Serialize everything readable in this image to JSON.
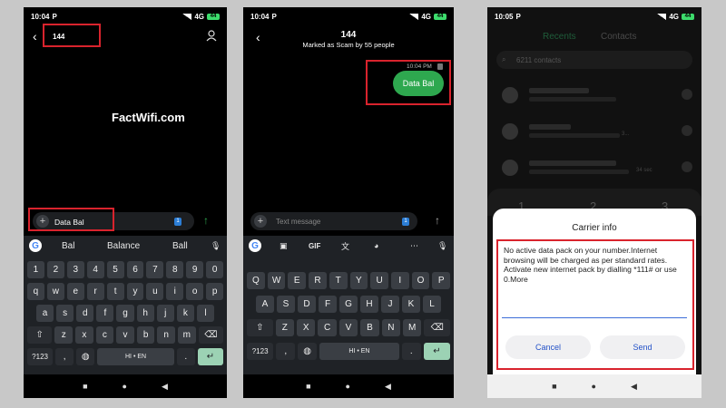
{
  "phone1": {
    "status": {
      "time": "10:04",
      "carrier_icon": "P",
      "network": "4G",
      "battery": "44"
    },
    "header": {
      "number": "144"
    },
    "watermark": "FactWifi.com",
    "compose": {
      "text": "Data Bal",
      "sim_badge": "1"
    },
    "suggestions": [
      "Bal",
      "Balance",
      "Ball"
    ],
    "keys": {
      "row1": [
        "1",
        "2",
        "3",
        "4",
        "5",
        "6",
        "7",
        "8",
        "9",
        "0"
      ],
      "row2": [
        "q",
        "w",
        "e",
        "r",
        "t",
        "y",
        "u",
        "i",
        "o",
        "p"
      ],
      "row3": [
        "a",
        "s",
        "d",
        "f",
        "g",
        "h",
        "j",
        "k",
        "l"
      ],
      "row4": [
        "z",
        "x",
        "c",
        "v",
        "b",
        "n",
        "m"
      ],
      "sym": "?123",
      "lang": "HI • EN",
      "dot": ".",
      "comma": ","
    }
  },
  "phone2": {
    "status": {
      "time": "10:04",
      "carrier_icon": "P",
      "network": "4G",
      "battery": "44"
    },
    "header": {
      "number": "144",
      "subtitle": "Marked as Scam by 55 people"
    },
    "message": {
      "time": "10:04 PM",
      "text": "Data Bal"
    },
    "compose": {
      "placeholder": "Text message",
      "sim_badge": "1"
    },
    "toolbar": {
      "gif": "GIF"
    },
    "keys": {
      "row1": [
        "Q",
        "W",
        "E",
        "R",
        "T",
        "Y",
        "U",
        "I",
        "O",
        "P"
      ],
      "row2": [
        "A",
        "S",
        "D",
        "F",
        "G",
        "H",
        "J",
        "K",
        "L"
      ],
      "row3": [
        "Z",
        "X",
        "C",
        "V",
        "B",
        "N",
        "M"
      ],
      "sym": "?123",
      "lang": "HI • EN",
      "dot": ".",
      "comma": ","
    }
  },
  "phone3": {
    "status": {
      "time": "10:05",
      "carrier_icon": "P",
      "network": "4G",
      "battery": "44"
    },
    "tabs": [
      "Recents",
      "Contacts"
    ],
    "search": "6211 contacts",
    "dial_digits": [
      "1",
      "2",
      "3"
    ],
    "recent_meta": [
      "3...",
      "34 sec"
    ],
    "dialog": {
      "title": "Carrier info",
      "body": "No active data pack on your number.Internet browsing will be charged as per standard rates. Activate new internet pack by dialling *111# or use\n0.More",
      "cancel": "Cancel",
      "send": "Send"
    }
  },
  "colors": {
    "accent_green": "#2ea84f",
    "highlight_red": "#d9232d",
    "dialog_button_text": "#2452c8"
  }
}
